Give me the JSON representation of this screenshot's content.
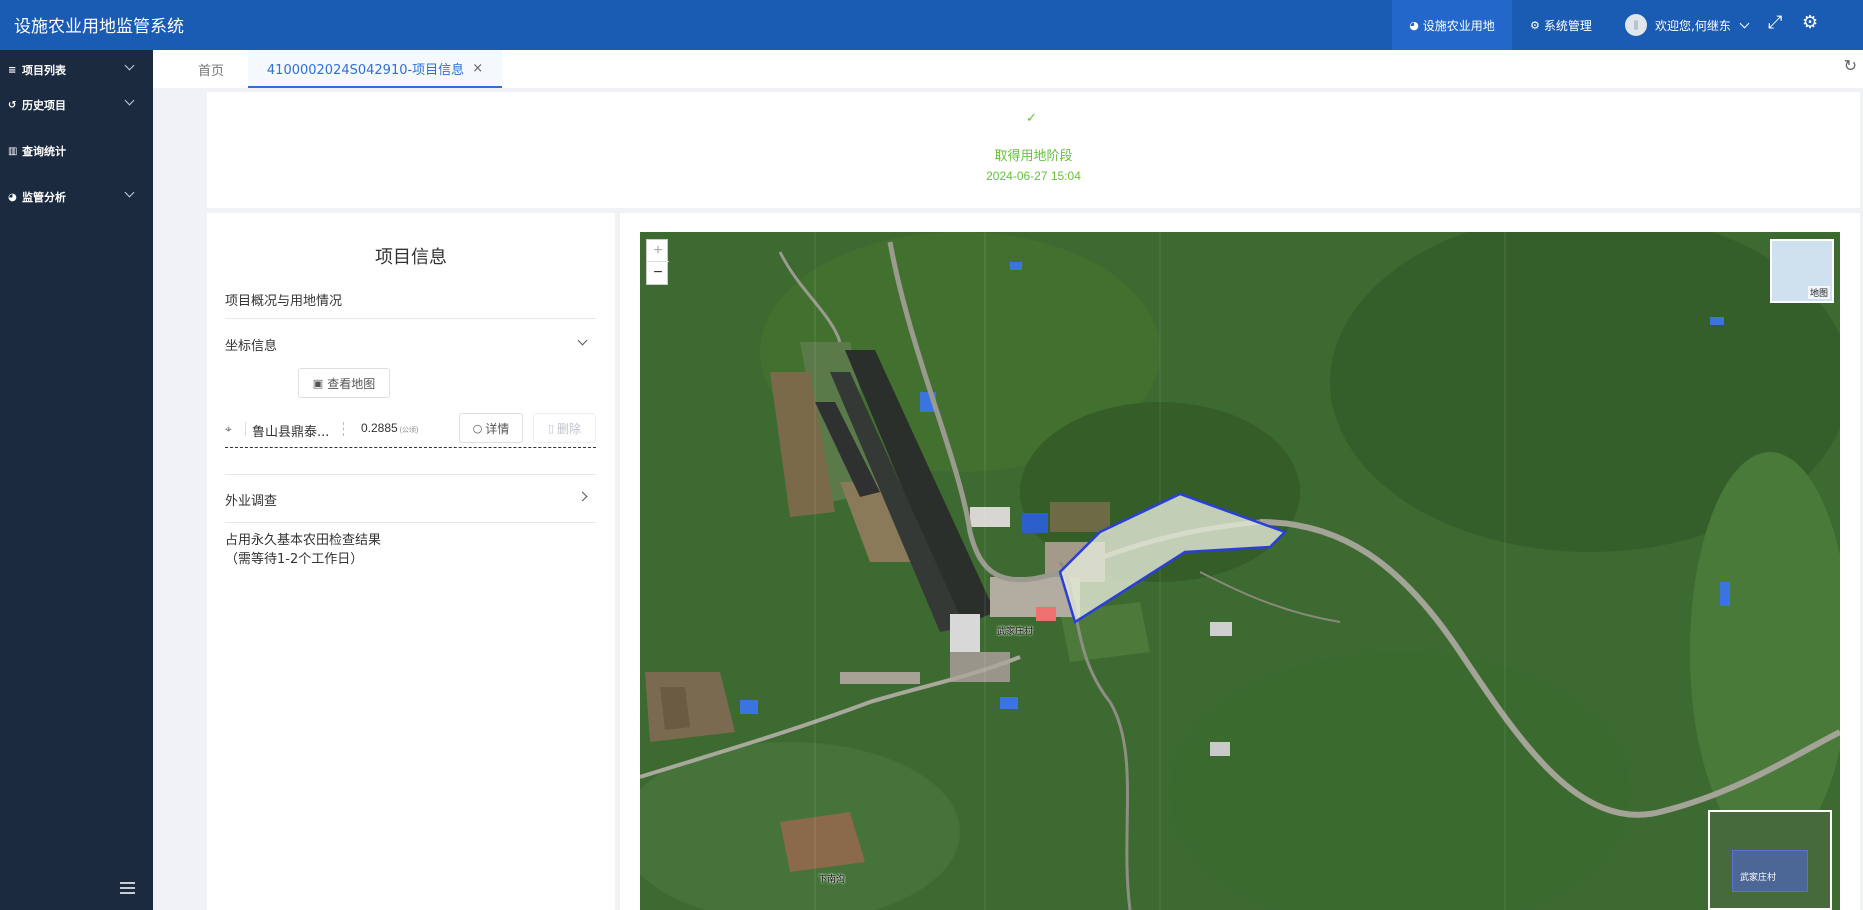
{
  "app": {
    "title": "设施农业用地监管系统"
  },
  "topnav": {
    "facility_land": "设施农业用地",
    "system_manage": "系统管理",
    "welcome": "欢迎您,何继东"
  },
  "sidebar": {
    "items": [
      {
        "label": "项目列表",
        "icon": "list-icon"
      },
      {
        "label": "历史项目",
        "icon": "history-icon"
      },
      {
        "label": "查询统计",
        "icon": "bar-chart-icon"
      },
      {
        "label": "监管分析",
        "icon": "pie-chart-icon"
      }
    ]
  },
  "tabs": {
    "home": "首页",
    "active": "4100002024S042910-项目信息",
    "close": "×"
  },
  "stage": {
    "name": "取得用地阶段",
    "time": "2024-06-27 15:04",
    "color": "#67c23a"
  },
  "info": {
    "title": "项目信息",
    "overview": "项目概况与用地情况",
    "coords": "坐标信息",
    "view_map": "查看地图",
    "coord_name": "鲁山县鼎泰...",
    "area": "0.2885",
    "area_unit": "(公顷)",
    "detail": "详情",
    "delete": "删除",
    "field_survey": "外业调查",
    "farmland_check_line1": "占用永久基本农田检查结果",
    "farmland_check_line2": "（需等待1-2个工作日）"
  },
  "map": {
    "zoom_in": "+",
    "zoom_out": "−",
    "layer_label": "地图",
    "village_label": "武家庄村",
    "village_label_2": "下南沟",
    "overview_label": "武家庄村",
    "parcel_color": "#2a3fd8"
  }
}
